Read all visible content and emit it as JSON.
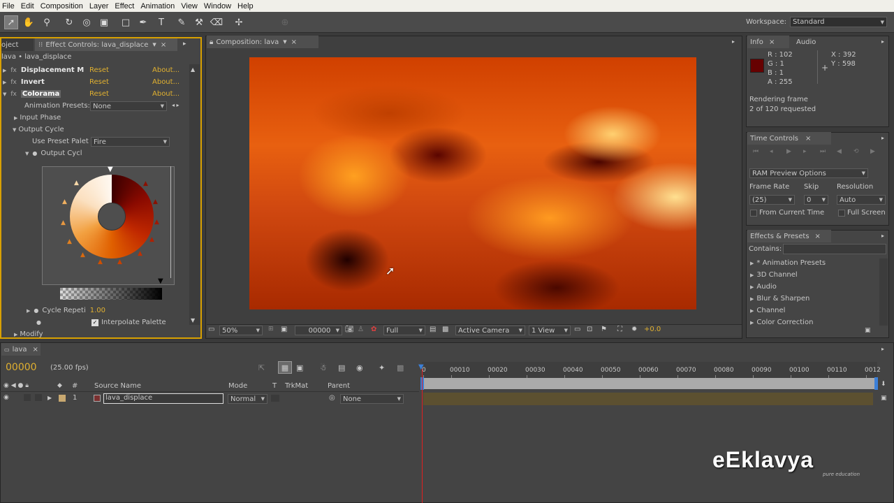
{
  "menu": [
    "File",
    "Edit",
    "Composition",
    "Layer",
    "Effect",
    "Animation",
    "View",
    "Window",
    "Help"
  ],
  "toolbar": {
    "workspace_label": "Workspace:",
    "workspace_value": "Standard"
  },
  "effect_controls": {
    "tab_project": "oject",
    "tab_title": "Effect Controls: lava_displace",
    "breadcrumb": "lava • lava_displace",
    "effects": [
      {
        "name": "Displacement M",
        "reset": "Reset",
        "about": "About..."
      },
      {
        "name": "Invert",
        "reset": "Reset",
        "about": "About..."
      },
      {
        "name": "Colorama",
        "reset": "Reset",
        "about": "About..."
      }
    ],
    "animation_presets_label": "Animation Presets:",
    "animation_presets_value": "None",
    "input_phase": "Input Phase",
    "output_cycle": "Output Cycle",
    "use_preset_label": "Use Preset Palet",
    "use_preset_value": "Fire",
    "output_cycl": "Output Cycl",
    "cycle_repeat_label": "Cycle Repeti",
    "cycle_repeat_value": "1.00",
    "interpolate_label": "Interpolate Palette",
    "modify": "Modify"
  },
  "composition": {
    "tab_title": "Composition: lava",
    "zoom": "50%",
    "timecode": "00000",
    "resolution": "Full",
    "camera": "Active Camera",
    "view": "1 View",
    "exposure": "+0.0"
  },
  "info": {
    "tab_info": "Info",
    "tab_audio": "Audio",
    "r": "R : 102",
    "g": "G : 1",
    "b": "B : 1",
    "a": "A : 255",
    "x": "X : 392",
    "y": "Y : 598",
    "swatch_color": "#660101",
    "status1": "Rendering frame",
    "status2": "2 of 120 requested"
  },
  "time_controls": {
    "tab": "Time Controls",
    "ram_preview": "RAM Preview Options",
    "frame_rate_label": "Frame Rate",
    "skip_label": "Skip",
    "resolution_label": "Resolution",
    "frame_rate_value": "(25)",
    "skip_value": "0",
    "resolution_value": "Auto",
    "from_current": "From Current Time",
    "full_screen": "Full Screen"
  },
  "effects_presets": {
    "tab": "Effects & Presets",
    "contains_label": "Contains:",
    "items": [
      "* Animation Presets",
      "3D Channel",
      "Audio",
      "Blur & Sharpen",
      "Channel",
      "Color Correction"
    ]
  },
  "timeline": {
    "tab": "lava",
    "timecode": "00000",
    "fps": "(25.00 fps)",
    "col_hash": "#",
    "col_source": "Source Name",
    "col_mode": "Mode",
    "col_t": "T",
    "col_trkmat": "TrkMat",
    "col_parent": "Parent",
    "layer_num": "1",
    "layer_name": "lava_displace",
    "layer_mode": "Normal",
    "layer_parent": "None",
    "ticks": [
      "0",
      "00010",
      "00020",
      "00030",
      "00040",
      "00050",
      "00060",
      "00070",
      "00080",
      "00090",
      "00100",
      "00110",
      "0012"
    ]
  },
  "watermark": {
    "brand": "eEklavya",
    "tagline": "pure education"
  }
}
